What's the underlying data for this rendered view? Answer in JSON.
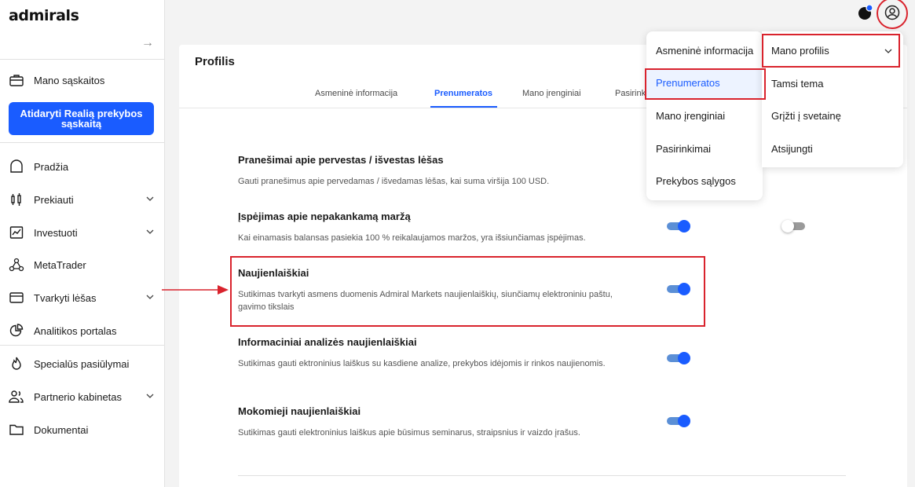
{
  "sidebar": {
    "logo": "admirals",
    "accounts": "Mano sąskaitos",
    "cta": "Atidaryti Realią prekybos sąskaitą",
    "items": [
      {
        "label": "Pradžia",
        "icon": "home-icon"
      },
      {
        "label": "Prekiauti",
        "icon": "candlestick-icon"
      },
      {
        "label": "Investuoti",
        "icon": "chart-icon"
      },
      {
        "label": "MetaTrader",
        "icon": "network-icon"
      },
      {
        "label": "Tvarkyti lėšas",
        "icon": "wallet-icon"
      },
      {
        "label": "Analitikos portalas",
        "icon": "pie-icon"
      },
      {
        "label": "Specialūs pasiūlymai",
        "icon": "flame-icon"
      },
      {
        "label": "Partnerio kabinetas",
        "icon": "users-icon"
      },
      {
        "label": "Dokumentai",
        "icon": "folder-icon"
      }
    ]
  },
  "profile": {
    "title": "Profilis",
    "tabs": [
      "Asmeninė informacija",
      "Prenumeratos",
      "Mano įrenginiai",
      "Pasirinkimai"
    ],
    "active_tab": "Prenumeratos"
  },
  "settings": [
    {
      "title": "Pranešimai apie pervestas / išvestas lėšas",
      "desc": "Gauti pranešimus apie pervedamas / išvedamas lėšas, kai suma viršija 100 USD."
    },
    {
      "title": "Įspėjimas apie nepakankamą maržą",
      "desc": "Kai einamasis balansas pasiekia 100 % reikalaujamos maržos, yra išsiunčiamas įspėjimas."
    },
    {
      "title": "Naujienlaiškiai",
      "desc": "Sutikimas tvarkyti asmens duomenis Admiral Markets naujienlaiškių, siunčiamų elektroniniu paštu, gavimo tikslais"
    },
    {
      "title": "Informaciniai analizės naujienlaiškiai",
      "desc": "Sutikimas gauti ektroninius laiškus su kasdiene analize, prekybos idėjomis ir rinkos naujienomis."
    },
    {
      "title": "Mokomieji naujienlaiškiai",
      "desc": "Sutikimas gauti elektroninius laiškus apie būsimus seminarus, straipsnius ir vaizdo įrašus."
    }
  ],
  "toggles": {
    "margin_email": "on",
    "margin_push": "off",
    "newsletters": "on",
    "analysis": "on",
    "educational": "on"
  },
  "dropdown": {
    "left": [
      "Asmeninė informacija",
      "Prenumeratos",
      "Mano įrenginiai",
      "Pasirinkimai",
      "Prekybos sąlygos"
    ],
    "right": [
      "Mano profilis",
      "Tamsi tema",
      "Grįžti į svetainę",
      "Atsijungti"
    ]
  },
  "colors": {
    "accent": "#1a5cff",
    "highlight": "#d9232d"
  }
}
